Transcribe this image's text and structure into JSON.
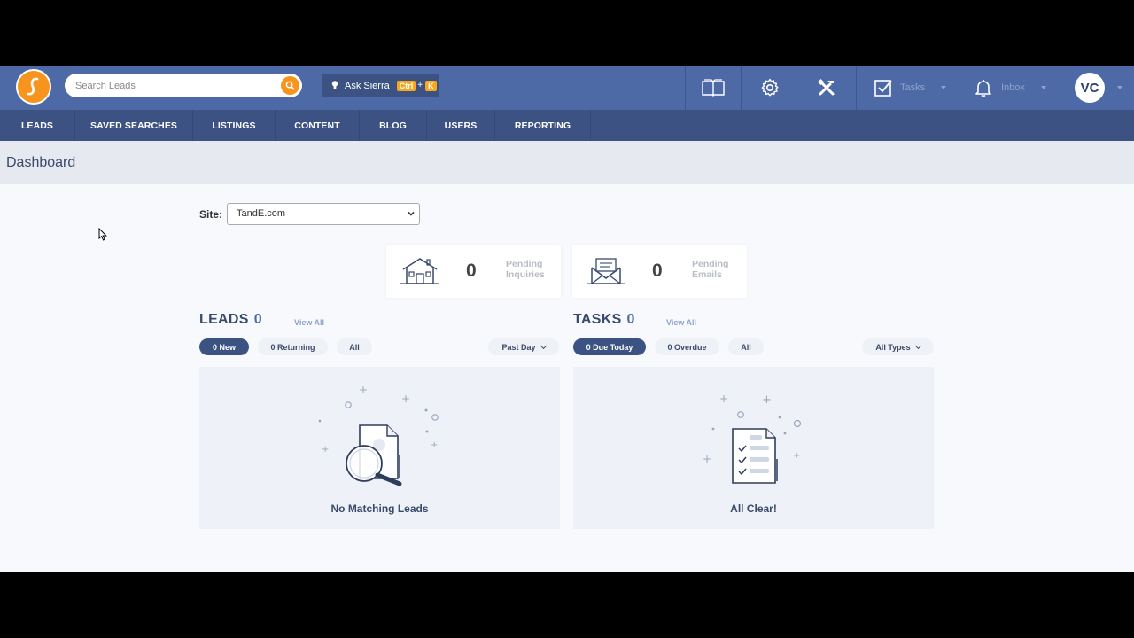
{
  "topbar": {
    "search_placeholder": "Search Leads",
    "ask_label": "Ask Sierra",
    "ask_key1": "Ctrl",
    "ask_plus": "+",
    "ask_key2": "K",
    "tasks_label": "Tasks",
    "inbox_label": "Inbox",
    "avatar_initials": "VC"
  },
  "nav": [
    {
      "label": "LEADS"
    },
    {
      "label": "SAVED SEARCHES"
    },
    {
      "label": "LISTINGS"
    },
    {
      "label": "CONTENT"
    },
    {
      "label": "BLOG"
    },
    {
      "label": "USERS"
    },
    {
      "label": "REPORTING"
    }
  ],
  "page": {
    "title": "Dashboard",
    "site_label": "Site:",
    "site_value": "TandE.com"
  },
  "stats": {
    "inquiries": {
      "value": "0",
      "label_line1": "Pending",
      "label_line2": "Inquiries"
    },
    "emails": {
      "value": "0",
      "label_line1": "Pending",
      "label_line2": "Emails"
    }
  },
  "leads": {
    "title": "LEADS",
    "count": "0",
    "view_all": "View All",
    "filters": [
      "0 New",
      "0 Returning",
      "All"
    ],
    "range": "Past Day",
    "empty": "No Matching Leads"
  },
  "tasks": {
    "title": "TASKS",
    "count": "0",
    "view_all": "View All",
    "filters": [
      "0 Due Today",
      "0 Overdue",
      "All"
    ],
    "types": "All Types",
    "empty": "All Clear!"
  },
  "colors": {
    "topbar": "#4e6aa6",
    "navbar": "#3c5283",
    "accent": "#f7941d"
  }
}
